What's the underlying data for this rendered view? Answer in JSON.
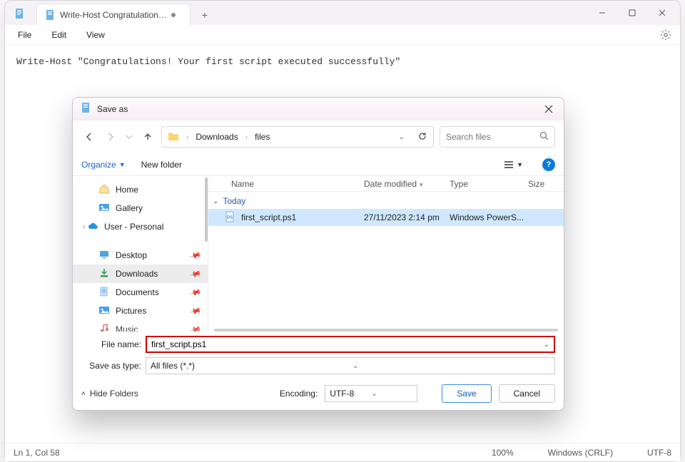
{
  "tab": {
    "title": "Write-Host Congratulations! Your f",
    "dirty": true
  },
  "menubar": [
    "File",
    "Edit",
    "View"
  ],
  "editor": {
    "line": "Write-Host \"Congratulations! Your first script executed successfully\""
  },
  "statusbar": {
    "cursor": "Ln 1, Col 58",
    "zoom": "100%",
    "eol": "Windows (CRLF)",
    "encoding": "UTF-8"
  },
  "dialog": {
    "title": "Save as",
    "breadcrumb": [
      "Downloads",
      "files"
    ],
    "search_placeholder": "Search files",
    "toolbar": {
      "organize": "Organize",
      "new_folder": "New folder"
    },
    "sidebar": {
      "items": [
        {
          "label": "Home",
          "icon": "home"
        },
        {
          "label": "Gallery",
          "icon": "gallery"
        },
        {
          "label": "User - Personal",
          "icon": "onedrive",
          "expandable": true
        }
      ],
      "places": [
        {
          "label": "Desktop",
          "icon": "desktop",
          "pinned": true
        },
        {
          "label": "Downloads",
          "icon": "downloads",
          "pinned": true,
          "selected": true
        },
        {
          "label": "Documents",
          "icon": "documents",
          "pinned": true
        },
        {
          "label": "Pictures",
          "icon": "pictures",
          "pinned": true
        },
        {
          "label": "Music",
          "icon": "music",
          "pinned": true,
          "partial": true
        }
      ]
    },
    "columns": [
      "Name",
      "Date modified",
      "Type",
      "Size"
    ],
    "group_label": "Today",
    "files": [
      {
        "name": "first_script.ps1",
        "modified": "27/11/2023 2:14 pm",
        "type": "Windows PowerS...",
        "size": ""
      }
    ],
    "file_name_label": "File name:",
    "file_name_value": "first_script.ps1",
    "save_type_label": "Save as type:",
    "save_type_value": "All files  (*.*)",
    "hide_folders": "Hide Folders",
    "encoding_label": "Encoding:",
    "encoding_value": "UTF-8",
    "btn_save": "Save",
    "btn_cancel": "Cancel"
  }
}
